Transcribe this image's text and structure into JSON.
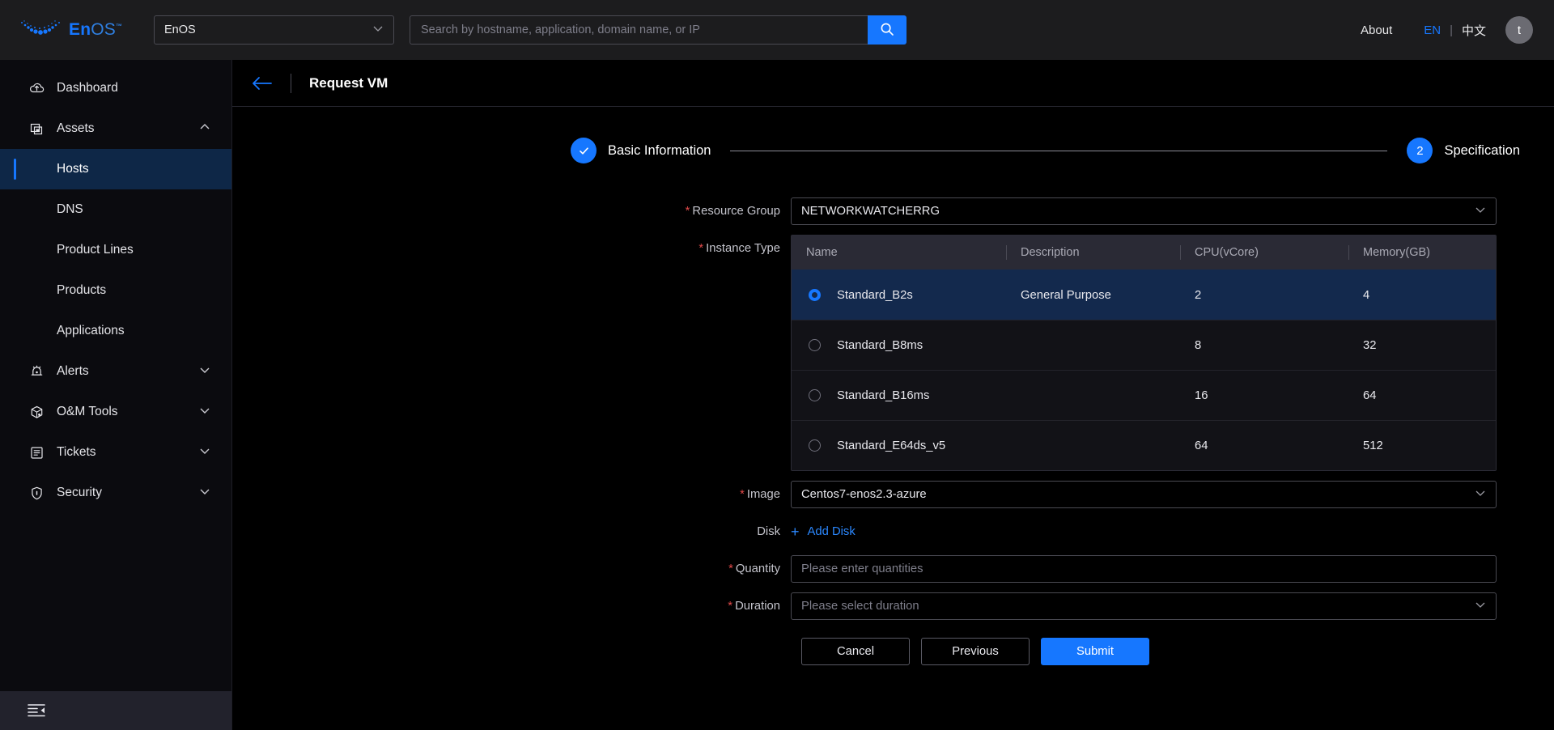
{
  "topbar": {
    "logo_text_en": "En",
    "logo_text_os": "OS",
    "logo_tm": "™",
    "logo_icon": "enos-dots-crescent-logo",
    "app_select_value": "EnOS",
    "search_placeholder": "Search by hostname, application, domain name, or IP",
    "search_value": "",
    "search_icon": "search-icon",
    "about_label": "About",
    "lang_en": "EN",
    "lang_divider": "|",
    "lang_cn": "中文",
    "avatar_initial": "t"
  },
  "sidebar": {
    "items": [
      {
        "label": "Dashboard",
        "icon": "dashboard-cloud-icon",
        "type": "item",
        "expandable": false
      },
      {
        "label": "Assets",
        "icon": "assets-window-icon",
        "type": "item",
        "expandable": true,
        "expanded": true
      },
      {
        "label": "Hosts",
        "type": "sub",
        "active": true
      },
      {
        "label": "DNS",
        "type": "sub",
        "active": false
      },
      {
        "label": "Product Lines",
        "type": "sub",
        "active": false
      },
      {
        "label": "Products",
        "type": "sub",
        "active": false
      },
      {
        "label": "Applications",
        "type": "sub",
        "active": false
      },
      {
        "label": "Alerts",
        "icon": "alert-bell-icon",
        "type": "item",
        "expandable": true,
        "expanded": false
      },
      {
        "label": "O&M Tools",
        "icon": "cube-tools-icon",
        "type": "item",
        "expandable": true,
        "expanded": false
      },
      {
        "label": "Tickets",
        "icon": "ticket-list-icon",
        "type": "item",
        "expandable": true,
        "expanded": false
      },
      {
        "label": "Security",
        "icon": "shield-icon",
        "type": "item",
        "expandable": true,
        "expanded": false
      }
    ],
    "collapse_icon": "collapse-sidebar-icon"
  },
  "page": {
    "back_icon": "back-arrow-icon",
    "title": "Request VM"
  },
  "stepper": {
    "steps": [
      {
        "marker": "✓",
        "label": "Basic Information",
        "state": "completed"
      },
      {
        "marker": "2",
        "label": "Specification",
        "state": "active"
      }
    ]
  },
  "form": {
    "resource_group": {
      "label": "Resource Group",
      "required": true,
      "value": "NETWORKWATCHERRG"
    },
    "instance_type": {
      "label": "Instance Type",
      "required": true
    },
    "image": {
      "label": "Image",
      "required": true,
      "value": "Centos7-enos2.3-azure"
    },
    "disk": {
      "label": "Disk",
      "required": false,
      "add_label": "Add Disk",
      "plus": "+"
    },
    "quantity": {
      "label": "Quantity",
      "required": true,
      "value": "",
      "placeholder": "Please enter quantities"
    },
    "duration": {
      "label": "Duration",
      "required": true,
      "placeholder": "Please select duration"
    }
  },
  "instance_table": {
    "columns": [
      "Name",
      "Description",
      "CPU(vCore)",
      "Memory(GB)"
    ],
    "rows": [
      {
        "selected": true,
        "name": "Standard_B2s",
        "description": "General Purpose",
        "cpu": "2",
        "memory": "4"
      },
      {
        "selected": false,
        "name": "Standard_B8ms",
        "description": "",
        "cpu": "8",
        "memory": "32"
      },
      {
        "selected": false,
        "name": "Standard_B16ms",
        "description": "",
        "cpu": "16",
        "memory": "64"
      },
      {
        "selected": false,
        "name": "Standard_E64ds_v5",
        "description": "",
        "cpu": "64",
        "memory": "512"
      }
    ]
  },
  "buttons": {
    "cancel": "Cancel",
    "previous": "Previous",
    "submit": "Submit"
  },
  "colors": {
    "accent": "#1677ff",
    "required_star": "#e24a4a",
    "selected_row": "#13294d",
    "table_header": "#2a2a35"
  }
}
